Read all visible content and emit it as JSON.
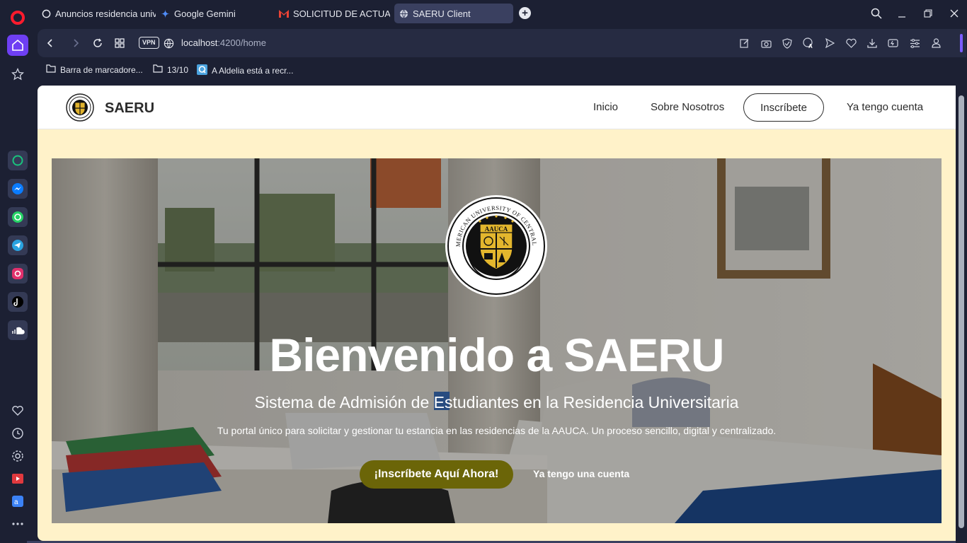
{
  "browser": {
    "tabs": [
      {
        "title": "Anuncios residencia unive",
        "icon": "chatgpt-icon",
        "active": false
      },
      {
        "title": "Google Gemini",
        "icon": "gemini-icon",
        "active": false
      },
      {
        "title": "SOLICITUD DE ACTUALIZA",
        "icon": "gmail-icon",
        "active": false
      },
      {
        "title": "SAERU Client",
        "icon": "globe-icon",
        "active": true
      }
    ],
    "address": {
      "host": "localhost",
      "path": ":4200/home",
      "vpn_label": "VPN"
    },
    "bookmarks": [
      {
        "label": "Barra de marcadore...",
        "icon": "folder-icon"
      },
      {
        "label": "13/10",
        "icon": "folder-icon"
      },
      {
        "label": "A Aldelia está a recr...",
        "icon": "qapp-icon"
      }
    ],
    "colors": {
      "accent": "#6e3ff3",
      "chrome": "#1c2033",
      "page_bg": "#fff2c9",
      "cta": "#6b6508"
    }
  },
  "site": {
    "brand": "SAERU",
    "nav": {
      "inicio": "Inicio",
      "about": "Sobre Nosotros",
      "signup": "Inscríbete",
      "login": "Ya tengo cuenta"
    },
    "hero": {
      "emblem_text": "AFRO-AMERICAN UNIVERSITY OF CENTRAL AFRICA",
      "emblem_shield": "AAUCA",
      "title": "Bienvenido a SAERU",
      "subtitle": "Sistema de Admisión de Estudiantes en la Residencia Universitaria",
      "description": "Tu portal único para solicitar y gestionar tu estancia en las residencias de la AAUCA. Un proceso sencillo, digital y centralizado.",
      "cta": "¡Inscríbete Aquí Ahora!",
      "secondary": "Ya tengo una cuenta"
    }
  }
}
